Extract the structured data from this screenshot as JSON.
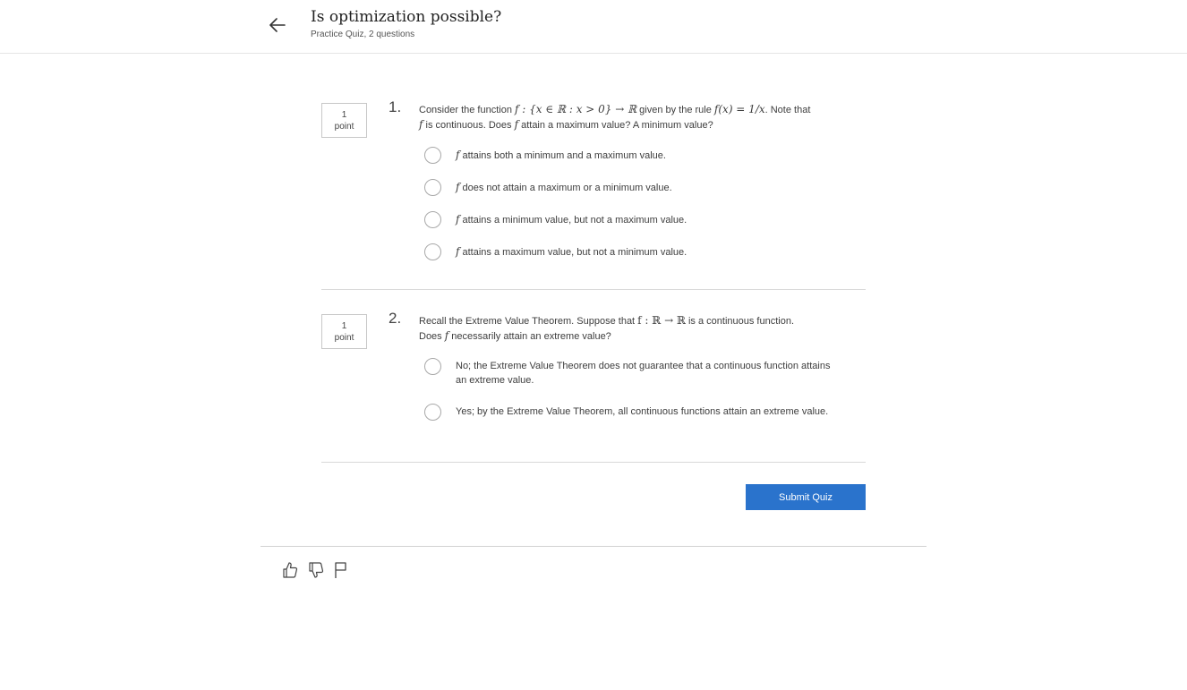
{
  "header": {
    "title": "Is optimization possible?",
    "subtitle": "Practice Quiz, 2 questions",
    "back_icon": "arrow-left-icon"
  },
  "questions": [
    {
      "number": "1.",
      "points_value": "1",
      "points_label": "point",
      "text_parts": {
        "a": "Consider the function ",
        "math1": "f : {x ∈ ℝ : x > 0} → ℝ",
        "b": " given by the rule ",
        "math2": "f(x) = 1/x",
        "c": ". Note that",
        "math3": "f",
        "d": " is continuous. Does ",
        "math4": "f",
        "e": " attain a maximum value? A minimum value?"
      },
      "options": [
        {
          "math": "f",
          "label": " attains both a minimum and a maximum value."
        },
        {
          "math": "f",
          "label": " does not attain a maximum or a minimum value."
        },
        {
          "math": "f",
          "label": " attains a minimum value, but not a maximum value."
        },
        {
          "math": "f",
          "label": " attains a maximum value, but not a minimum value."
        }
      ]
    },
    {
      "number": "2.",
      "points_value": "1",
      "points_label": "point",
      "text_parts": {
        "a": "Recall the Extreme Value Theorem. Suppose that ",
        "math1": "f : ℝ → ℝ",
        "b": " is a continuous function.",
        "c": "Does ",
        "math2": "f",
        "d": " necessarily attain an extreme value?"
      },
      "options": [
        {
          "label": "No; the Extreme Value Theorem does not guarantee that a continuous function attains an extreme value."
        },
        {
          "label": "Yes; by the Extreme Value Theorem, all continuous functions attain an extreme value."
        }
      ]
    }
  ],
  "submit_label": "Submit Quiz",
  "footer_icons": [
    "thumbs-up-icon",
    "thumbs-down-icon",
    "flag-icon"
  ],
  "colors": {
    "accent": "#2a73cc",
    "divider": "#d9d9d9"
  }
}
